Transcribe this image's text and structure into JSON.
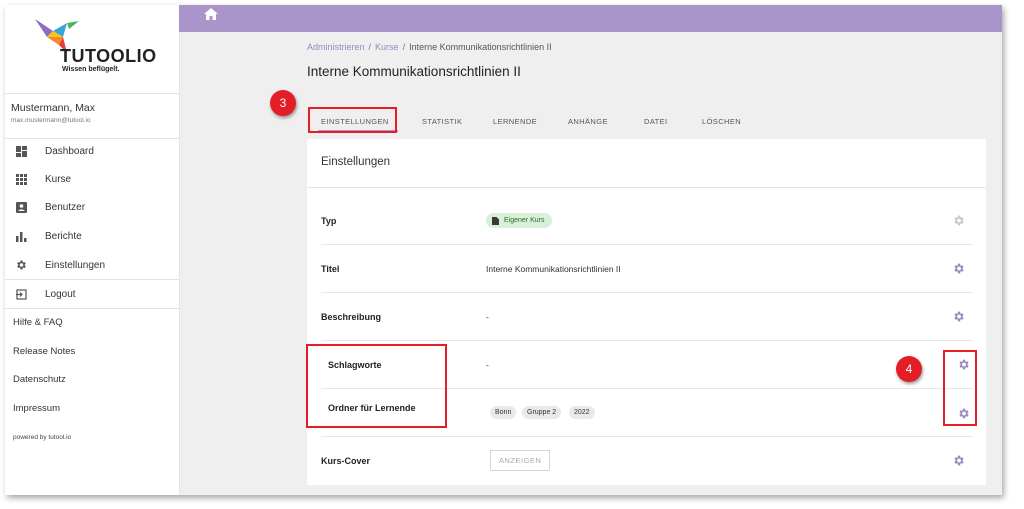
{
  "brand": {
    "name": "TUTOOLIO",
    "tagline": "Wissen beflügelt."
  },
  "user": {
    "name": "Mustermann, Max",
    "email": "max.mustermann@tutool.io"
  },
  "nav": [
    {
      "label": "Dashboard",
      "icon": "dashboard-icon"
    },
    {
      "label": "Kurse",
      "icon": "grid-icon"
    },
    {
      "label": "Benutzer",
      "icon": "user-card-icon"
    },
    {
      "label": "Berichte",
      "icon": "bar-chart-icon"
    },
    {
      "label": "Einstellungen",
      "icon": "gear-icon"
    }
  ],
  "logout": "Logout",
  "links": [
    "Hilfe & FAQ",
    "Release Notes",
    "Datenschutz",
    "Impressum"
  ],
  "powered": "powered by tutool.io",
  "breadcrumb": [
    "Administrieren",
    "Kurse",
    "Interne Kommunikationsrichtlinien II"
  ],
  "page_title": "Interne Kommunikationsrichtlinien II",
  "tabs": [
    "Einstellungen",
    "Statistik",
    "Lernende",
    "Anhänge",
    "Datei",
    "Löschen"
  ],
  "card": {
    "title": "Einstellungen",
    "rows": [
      {
        "label": "Typ",
        "value": "Eigener Kurs"
      },
      {
        "label": "Titel",
        "value": "Interne Kommunikationsrichtlinien II"
      },
      {
        "label": "Beschreibung",
        "value": "-"
      },
      {
        "label": "Schlagworte",
        "value": "-"
      },
      {
        "label": "Ordner für Lernende",
        "chips": [
          "Bonn",
          "Gruppe 2",
          "2022"
        ]
      },
      {
        "label": "Kurs-Cover",
        "button": "ANZEIGEN"
      }
    ]
  },
  "callouts": [
    "3",
    "4"
  ],
  "colors": {
    "accent": "#a995c9",
    "annotation": "#e41e26",
    "badge": "#d8efd8"
  }
}
